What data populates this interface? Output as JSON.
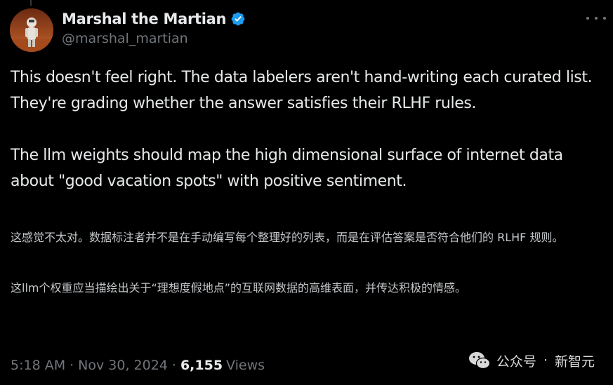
{
  "author": {
    "display_name": "Marshal the Martian",
    "handle": "@marshal_martian"
  },
  "tweet": {
    "paragraphs": [
      "This doesn't feel right. The data labelers aren't hand-writing each curated list. They're grading whether the answer satisfies their RLHF rules.",
      "The llm weights should map the high dimensional surface of internet data about \"good vacation spots\" with positive sentiment."
    ]
  },
  "translation": {
    "paragraphs": [
      "这感觉不太对。数据标注者并不是在手动编写每个整理好的列表，而是在评估答案是否符合他们的 RLHF 规则。",
      "这llm个权重应当描绘出关于“理想度假地点”的互联网数据的高维表面，并传达积极的情感。"
    ]
  },
  "meta": {
    "time": "5:18 AM",
    "separator": "·",
    "date": "Nov 30, 2024",
    "views_count": "6,155",
    "views_label": "Views"
  },
  "watermark": {
    "source": "公众号",
    "separator": "·",
    "name": "新智元"
  },
  "icons": {
    "verified": "verified-badge-icon",
    "more": "more-icon",
    "wechat": "wechat-icon"
  },
  "colors": {
    "background": "#000000",
    "text_primary": "#e7e9ea",
    "text_secondary": "#71767b",
    "verified_blue": "#1d9bf0"
  }
}
